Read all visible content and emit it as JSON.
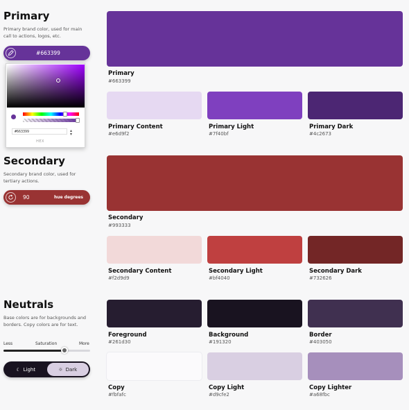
{
  "primary": {
    "title": "Primary",
    "description": "Primary brand color, used for main call to actions, logos, etc.",
    "hex_input": "#663399",
    "picker": {
      "hex_value": "#663399",
      "mode": "HEX",
      "toggle_icon": "up-down-arrows-icon",
      "hue_level": 0.75,
      "alpha_level": 1.0
    }
  },
  "secondary": {
    "title": "Secondary",
    "description": "Secondary brand color, used for tertiary actions.",
    "hue_value": "90",
    "hue_unit": "hue degrees"
  },
  "neutrals": {
    "title": "Neutrals",
    "description": "Base colors are for backgrounds and borders. Copy colors are for text.",
    "saturation": {
      "less_label": "Less",
      "label": "Saturation",
      "more_label": "More",
      "level": 0.7
    },
    "mode_toggle": {
      "light_label": "Light",
      "dark_label": "Dark",
      "selected": "Dark"
    }
  },
  "swatches": [
    {
      "name": "Primary",
      "hex": "#663399",
      "color": "#663399"
    },
    {
      "name": "Primary Content",
      "hex": "#e6d9f2",
      "color": "#e6d9f2"
    },
    {
      "name": "Primary Light",
      "hex": "#7f40bf",
      "color": "#7f40bf"
    },
    {
      "name": "Primary Dark",
      "hex": "#4c2673",
      "color": "#4c2673"
    },
    {
      "name": "Secondary",
      "hex": "#993333",
      "color": "#993333"
    },
    {
      "name": "Secondary Content",
      "hex": "#f2d9d9",
      "color": "#f2d9d9"
    },
    {
      "name": "Secondary Light",
      "hex": "#bf4040",
      "color": "#bf4040"
    },
    {
      "name": "Secondary Dark",
      "hex": "#732626",
      "color": "#732626"
    },
    {
      "name": "Foreground",
      "hex": "#261d30",
      "color": "#261d30"
    },
    {
      "name": "Background",
      "hex": "#191320",
      "color": "#191320"
    },
    {
      "name": "Border",
      "hex": "#403050",
      "color": "#403050"
    },
    {
      "name": "Copy",
      "hex": "#fbfafc",
      "color": "#fbfafc"
    },
    {
      "name": "Copy Light",
      "hex": "#d9cfe2",
      "color": "#d9cfe2"
    },
    {
      "name": "Copy Lighter",
      "hex": "#a68fbc",
      "color": "#a68fbc"
    }
  ],
  "icons": {
    "eyedropper": "eyedropper-icon",
    "refresh": "refresh-icon",
    "sun": "sun-icon",
    "moon": "moon-icon"
  }
}
